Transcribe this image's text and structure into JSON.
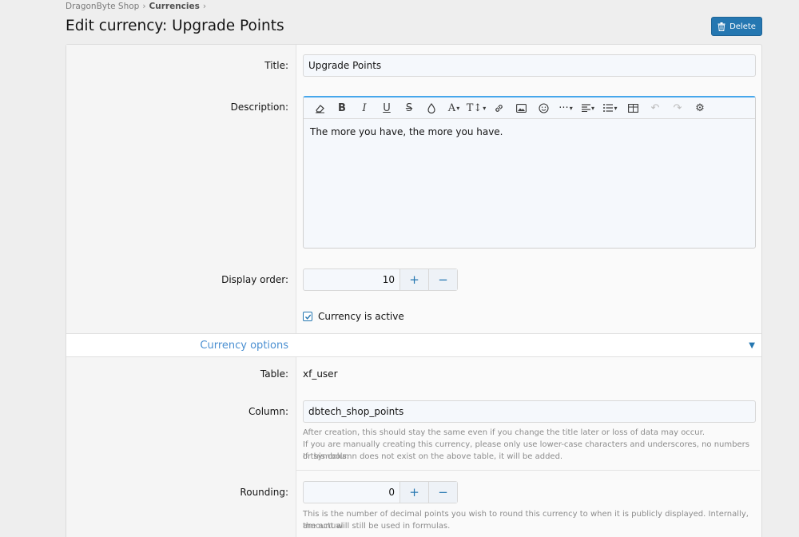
{
  "breadcrumb": {
    "items": [
      "DragonByte Shop",
      "Currencies"
    ],
    "separator": "›"
  },
  "page": {
    "title": "Edit currency: Upgrade Points",
    "delete_label": "Delete"
  },
  "form": {
    "title_label": "Title:",
    "title_value": "Upgrade Points",
    "description_label": "Description:",
    "description_value": "The more you have, the more you have.",
    "display_order_label": "Display order:",
    "display_order_value": "10",
    "active_label": "Currency is active",
    "active_checked": true
  },
  "toolbar": {
    "buttons": [
      "eraser-icon",
      "bold-icon",
      "italic-icon",
      "underline-icon",
      "strikethrough-icon",
      "color-icon",
      "font-family-icon",
      "font-size-icon",
      "link-icon",
      "image-icon",
      "smilie-icon",
      "more-icon",
      "align-icon",
      "list-icon",
      "table-icon",
      "undo-icon",
      "redo-icon",
      "settings-icon"
    ]
  },
  "options_section": {
    "title": "Currency options",
    "table_label": "Table:",
    "table_value": "xf_user",
    "column_label": "Column:",
    "column_value": "dbtech_shop_points",
    "column_hint_1": "After creation, this should stay the same even if you change the title later or loss of data may occur.",
    "column_hint_2": "If you are manually creating this currency, please only use lower-case characters and underscores, no numbers or symbols.",
    "column_hint_3": "If this column does not exist on the above table, it will be added.",
    "rounding_label": "Rounding:",
    "rounding_value": "0",
    "rounding_hint_1": "This is the number of decimal points you wish to round this currency to when it is publicly displayed. Internally, the actual",
    "rounding_hint_2": "amount will still be used in formulas."
  },
  "stepper": {
    "plus": "+",
    "minus": "−"
  },
  "colors": {
    "accent": "#2577b1",
    "editor_focus": "#47a7eb",
    "section_title": "#4a8fd1"
  }
}
